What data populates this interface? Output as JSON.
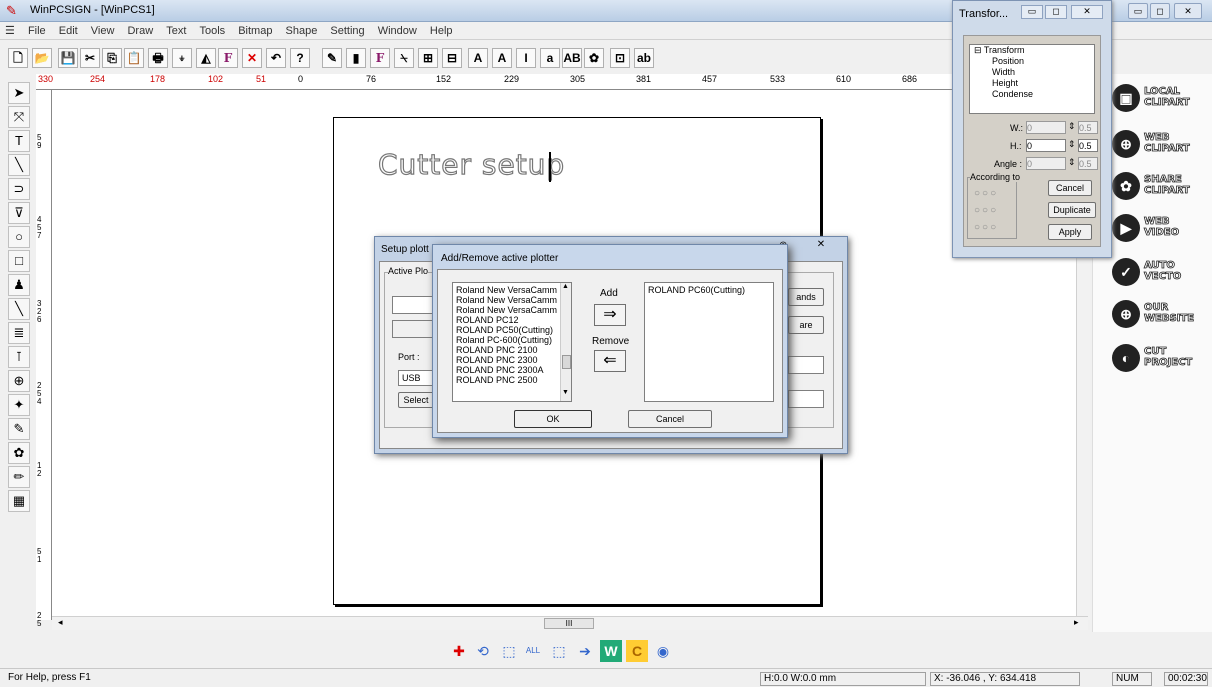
{
  "window": {
    "title": "WinPCSIGN - [WinPCS1]"
  },
  "menu": [
    "File",
    "Edit",
    "View",
    "Draw",
    "Text",
    "Tools",
    "Bitmap",
    "Shape",
    "Setting",
    "Window",
    "Help"
  ],
  "toolbar": {
    "icons": [
      "new-icon",
      "open-icon",
      "save-icon",
      "cut-icon",
      "copy-icon",
      "paste-icon",
      "print-icon",
      "cutter-icon",
      "vectorize-icon",
      "font-icon",
      "delete-icon",
      "undo-icon",
      "help-icon",
      "pen-icon",
      "bitmap-icon",
      "font-f-icon",
      "mirror-icon",
      "fit-icon",
      "fit2-icon",
      "text-a-icon",
      "text-a2-icon",
      "italic-icon",
      "text-a3-icon",
      "text-ab-icon",
      "brush-icon",
      "symbol-icon",
      "ab-icon"
    ],
    "glyphs": [
      "🗋",
      "📂",
      "💾",
      "✂",
      "⎘",
      "📋",
      "🖶",
      "⍖",
      "◭",
      "F",
      "✕",
      "↶",
      "?",
      "✎",
      "▮",
      "F",
      "⍀",
      "⊞",
      "⊟",
      "A",
      "A",
      "I",
      "a",
      "AB",
      "✿",
      "⊡",
      "ab"
    ]
  },
  "ruler_h": [
    "330",
    "254",
    "178",
    "102",
    "51",
    "0",
    "76",
    "152",
    "229",
    "305",
    "381",
    "457",
    "533",
    "610",
    "686",
    "76"
  ],
  "ruler_v": [
    {
      "t": "5\n9"
    },
    {
      "t": "4\n5\n7"
    },
    {
      "t": "3\n2\n6"
    },
    {
      "t": "2\n5\n4"
    },
    {
      "t": "1\n2"
    },
    {
      "t": "5\n1"
    },
    {
      "t": "2\n5"
    }
  ],
  "left_tools": [
    "pointer-tool-icon",
    "node-tool-icon",
    "text-tool-icon",
    "line-tool-icon",
    "arc-tool-icon",
    "curve-tool-icon",
    "ellipse-tool-icon",
    "rectangle-tool-icon",
    "fill-tool-icon",
    "knife-tool-icon",
    "align-tool-icon",
    "text-fit-tool-icon",
    "zoom-tool-icon",
    "eraser-tool-icon",
    "paint-tool-icon",
    "palette-tool-icon",
    "pencil-tool-icon",
    "calculator-tool-icon"
  ],
  "left_tool_glyphs": [
    "➤",
    "⤧",
    "T",
    "╲",
    "⊃",
    "⊽",
    "○",
    "□",
    "♟",
    "╲",
    "≣",
    "⊺",
    "⊕",
    "✦",
    "✎",
    "✿",
    "✏",
    "▦"
  ],
  "canvas": {
    "text": "Cutter setup"
  },
  "transform_panel": {
    "title": "Transfor...",
    "tree": [
      "⊟ Transform",
      "Position",
      "Width",
      "Height",
      "Condense"
    ],
    "w_label": "W.:",
    "w_value": "0",
    "w_step": "0.5",
    "h_label": "H.:",
    "h_value": "0",
    "h_step": "0.5",
    "angle_label": "Angle :",
    "angle_value": "0",
    "angle_step": "0.5",
    "according_label": "According to",
    "cancel": "Cancel",
    "duplicate": "Duplicate",
    "apply": "Apply"
  },
  "setup_dialog": {
    "title": "Setup plott",
    "active_label": "Active Plo",
    "port_label": "Port :",
    "port_value": "USB",
    "select_label": "Select",
    "btn1": "ands",
    "btn2": "are"
  },
  "add_remove_dialog": {
    "title": "Add/Remove active plotter",
    "available": [
      "Roland New VersaCamm",
      "Roland New VersaCamm",
      "Roland New VersaCamm",
      "ROLAND PC12",
      "ROLAND PC50(Cutting)",
      "Roland PC-600(Cutting)",
      "ROLAND PNC 2100",
      "ROLAND PNC 2300",
      "ROLAND PNC 2300A",
      "ROLAND PNC 2500"
    ],
    "active": [
      "ROLAND PC60(Cutting)"
    ],
    "add": "Add",
    "remove": "Remove",
    "ok": "OK",
    "cancel": "Cancel"
  },
  "right_panel": [
    {
      "label": "LOCAL\nCLIPART",
      "icon": "local-clipart-icon"
    },
    {
      "label": "WEB\nCLIPART",
      "icon": "web-clipart-icon"
    },
    {
      "label": "SHARE\nCLIPART",
      "icon": "share-clipart-icon"
    },
    {
      "label": "WEB\nVIDEO",
      "icon": "web-video-icon"
    },
    {
      "label": "AUTO\nVECTO",
      "icon": "auto-vecto-icon"
    },
    {
      "label": "OUR\nWEBSITE",
      "icon": "our-website-icon"
    },
    {
      "label": "CUT\nPROJECT",
      "icon": "cut-project-icon"
    }
  ],
  "scroll": {
    "hscroll_grip": "III"
  },
  "bottom_tools": [
    "add-node-icon",
    "node2-icon",
    "node3-icon",
    "all-icon",
    "node4-icon",
    "node5-icon",
    "w-icon",
    "cut-c-icon",
    "globe-icon"
  ],
  "bottom_glyphs": [
    "✚",
    "⟲",
    "⬚",
    "ALL",
    "⬚",
    "➔",
    "W",
    "C",
    "◉"
  ],
  "status": {
    "help": "For Help, press F1",
    "size": "H:0.0  W:0.0 mm",
    "coords": "X: -36.046 , Y: 634.418",
    "num": "NUM",
    "time": "00:02:30"
  }
}
